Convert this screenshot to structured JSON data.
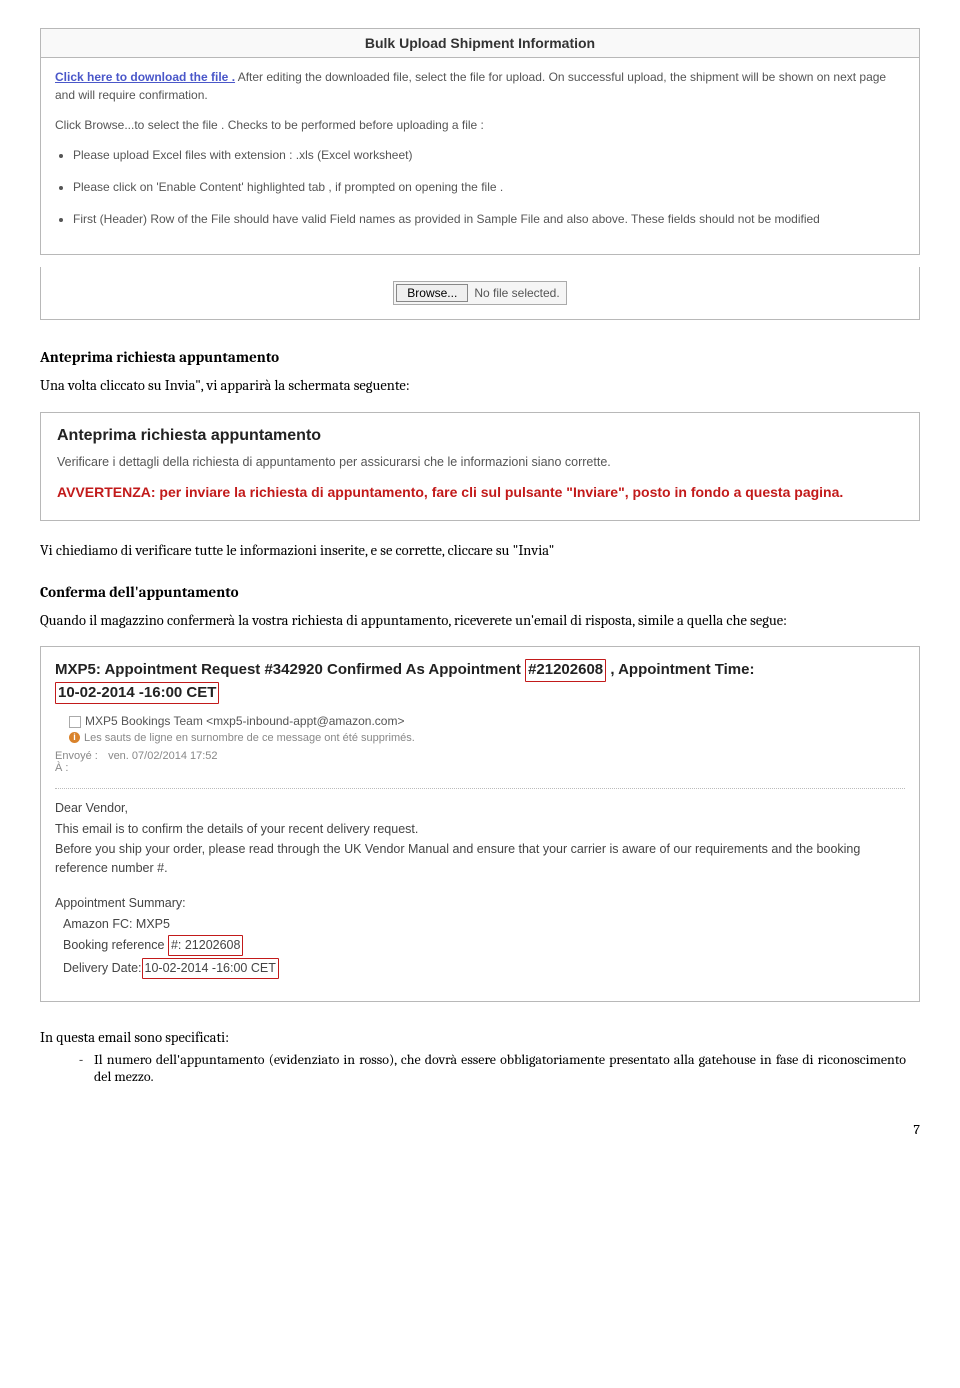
{
  "upload_panel": {
    "title": "Bulk Upload Shipment Information",
    "link_text": "Click here to download the file .",
    "after_link": " After editing the downloaded file, select the file for upload. On successful upload, the shipment will be shown on next page and will require confirmation.",
    "browse_intro": "Click Browse...to select the file . Checks to be performed before uploading a file :",
    "bullets": [
      "Please upload Excel files with extension : .xls (Excel worksheet)",
      "Please click on 'Enable Content' highlighted tab , if prompted on opening the file .",
      "First (Header) Row of the File should have valid Field names as provided in Sample File and also above. These fields should not be modified"
    ]
  },
  "file_picker": {
    "button": "Browse...",
    "status": "No file selected."
  },
  "section1": {
    "title": "Anteprima richiesta appuntamento",
    "text": "Una volta cliccato su Invia\", vi apparirà la schermata seguente:"
  },
  "warn_panel": {
    "title": "Anteprima richiesta appuntamento",
    "desc": "Verificare i dettagli della richiesta di appuntamento per assicurarsi che le informazioni siano corrette.",
    "warn": "AVVERTENZA: per inviare la richiesta di appuntamento, fare cli sul pulsante \"Inviare\", posto in fondo a questa pagina."
  },
  "section2": {
    "verify": "Vi chiediamo di verificare tutte le informazioni inserite, e se corrette, cliccare su \"Invia\"",
    "title": "Conferma dell'appuntamento",
    "text": "Quando il magazzino confermerà la vostra richiesta di appuntamento, riceverete un'email di risposta, simile a quella che segue:"
  },
  "email": {
    "subject_prefix": "MXP5: Appointment Request #342920 Confirmed As Appointment ",
    "appt_num": "#21202608",
    "subject_suffix1": " , Appointment Time:",
    "subject_time": "10-02-2014 -16:00 CET",
    "from": "MXP5 Bookings Team <mxp5-inbound-appt@amazon.com>",
    "note": "Les sauts de ligne en surnombre de ce message ont été supprimés.",
    "sent_label": "Envoyé :",
    "sent_value": "ven. 07/02/2014 17:52",
    "to_label": "À :",
    "greeting": "Dear Vendor,",
    "line1": "This email is to confirm the details of your recent delivery request.",
    "line2": "Before you ship your order, please read through the UK Vendor Manual and ensure that your carrier is aware of our requirements and the booking reference number #.",
    "summary_title": "Appointment Summary:",
    "fc": "Amazon FC: MXP5",
    "booking_label": "Booking reference ",
    "booking_value": "#: 21202608",
    "delivery_label": "Delivery Date:",
    "delivery_value": "10-02-2014 -16:00 CET"
  },
  "after_email": {
    "intro": "In questa email sono specificati:",
    "bullet1": "Il numero dell'appuntamento (evidenziato in rosso), che dovrà essere obbligatoriamente presentato alla gatehouse in fase di riconoscimento del mezzo."
  },
  "page_num": "7"
}
